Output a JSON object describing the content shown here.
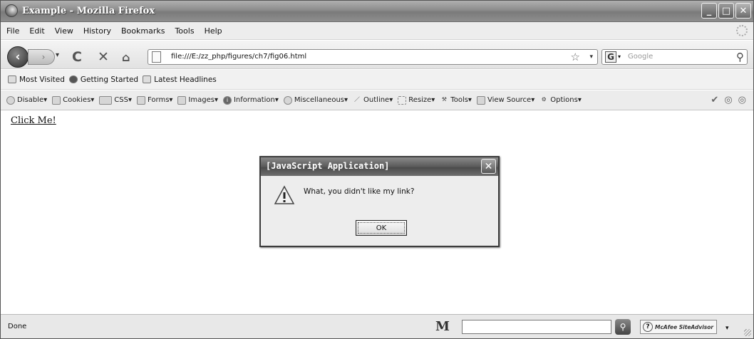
{
  "window": {
    "title": "Example - Mozilla Firefox"
  },
  "menu": [
    "File",
    "Edit",
    "View",
    "History",
    "Bookmarks",
    "Tools",
    "Help"
  ],
  "nav": {
    "url": "file:///E:/zz_php/figures/ch7/fig06.html",
    "search_placeholder": "Google",
    "search_engine_glyph": "G"
  },
  "bookmarks": [
    "Most Visited",
    "Getting Started",
    "Latest Headlines"
  ],
  "devbar": [
    {
      "label": "Disable▾",
      "icon": "disable-icon"
    },
    {
      "label": "Cookies▾",
      "icon": "cookies-icon"
    },
    {
      "label": "CSS▾",
      "icon": "css-icon"
    },
    {
      "label": "Forms▾",
      "icon": "forms-icon"
    },
    {
      "label": "Images▾",
      "icon": "images-icon"
    },
    {
      "label": "Information▾",
      "icon": "information-icon"
    },
    {
      "label": "Miscellaneous▾",
      "icon": "miscellaneous-icon"
    },
    {
      "label": "Outline▾",
      "icon": "outline-icon"
    },
    {
      "label": "Resize▾",
      "icon": "resize-icon"
    },
    {
      "label": "Tools▾",
      "icon": "tools-icon"
    },
    {
      "label": "View Source▾",
      "icon": "view-source-icon"
    },
    {
      "label": "Options▾",
      "icon": "options-icon"
    }
  ],
  "content": {
    "link_text": "Click Me!"
  },
  "dialog": {
    "title": "[JavaScript Application]",
    "message": "What, you didn't like my link?",
    "ok_label": "OK"
  },
  "status": {
    "text": "Done",
    "m_logo": "M",
    "site_advisor": "McAfee SiteAdvisor"
  }
}
